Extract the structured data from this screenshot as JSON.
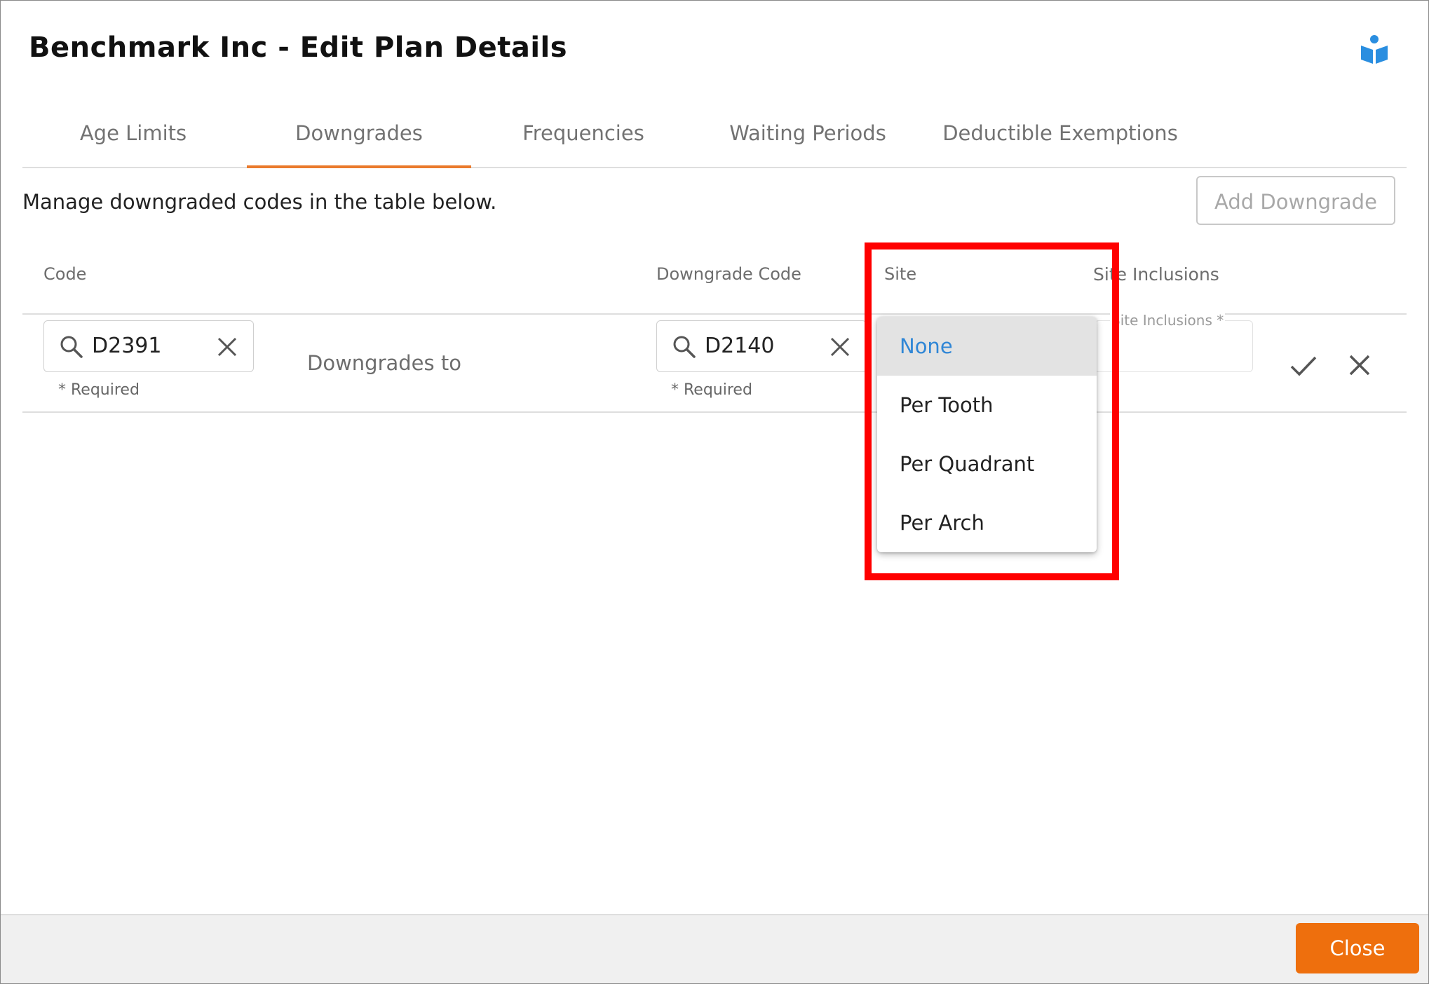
{
  "modal": {
    "title": "Benchmark Inc - Edit Plan Details",
    "help_icon": "book-reader-icon"
  },
  "tabs": [
    {
      "label": "Age Limits",
      "active": false
    },
    {
      "label": "Downgrades",
      "active": true
    },
    {
      "label": "Frequencies",
      "active": false
    },
    {
      "label": "Waiting Periods",
      "active": false
    },
    {
      "label": "Deductible Exemptions",
      "active": false
    }
  ],
  "intro_text": "Manage downgraded codes in the table below.",
  "add_button": "Add Downgrade",
  "table": {
    "headers": {
      "code": "Code",
      "downgrade_code": "Downgrade Code",
      "site": "Site",
      "site_inclusions": "Site Inclusions"
    },
    "row": {
      "code_value": "D2391",
      "code_required": "* Required",
      "downgrades_to": "Downgrades to",
      "downgrade_code_value": "D2140",
      "downgrade_required": "* Required",
      "site_inclusions_placeholder": "Site Inclusions *"
    }
  },
  "site_dropdown": {
    "selected": "None",
    "options": [
      "None",
      "Per Tooth",
      "Per Quadrant",
      "Per Arch"
    ]
  },
  "footer": {
    "close_button": "Close"
  },
  "colors": {
    "accent_orange": "#ee6f0d",
    "tab_underline": "#ea7a2c",
    "selected_blue": "#2f86d6",
    "highlight_red": "#ff0000"
  }
}
